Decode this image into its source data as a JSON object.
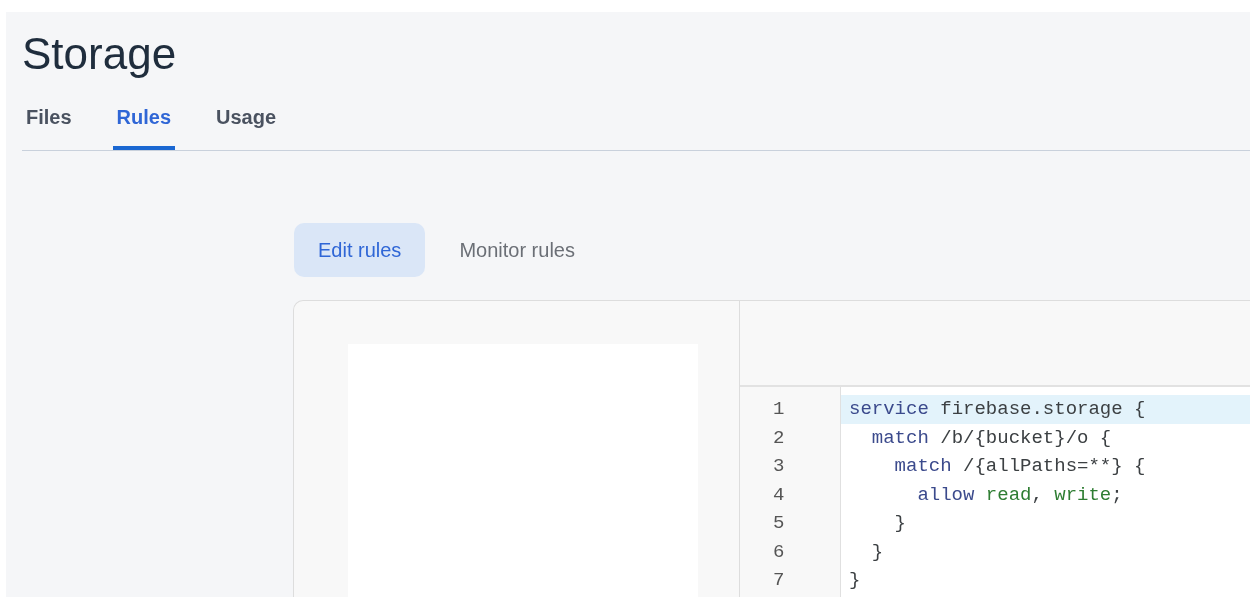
{
  "page": {
    "title": "Storage"
  },
  "tabs": [
    {
      "label": "Files",
      "selected": false
    },
    {
      "label": "Rules",
      "selected": true
    },
    {
      "label": "Usage",
      "selected": false
    }
  ],
  "subtabs": [
    {
      "label": "Edit rules",
      "selected": true
    },
    {
      "label": "Monitor rules",
      "selected": false
    }
  ],
  "editor": {
    "lines": [
      {
        "number": "1",
        "active": true,
        "tokens": [
          {
            "kind": "keyword",
            "text": "service"
          },
          {
            "kind": "plain",
            "text": " firebase.storage {"
          }
        ]
      },
      {
        "number": "2",
        "active": false,
        "tokens": [
          {
            "kind": "keyword",
            "text": "  match"
          },
          {
            "kind": "plain",
            "text": " /b/{bucket}/o {"
          }
        ]
      },
      {
        "number": "3",
        "active": false,
        "tokens": [
          {
            "kind": "keyword",
            "text": "    match"
          },
          {
            "kind": "plain",
            "text": " /{allPaths=**} {"
          }
        ]
      },
      {
        "number": "4",
        "active": false,
        "tokens": [
          {
            "kind": "keyword",
            "text": "      allow"
          },
          {
            "kind": "value",
            "text": " read"
          },
          {
            "kind": "plain",
            "text": ", "
          },
          {
            "kind": "value",
            "text": "write"
          },
          {
            "kind": "plain",
            "text": ";"
          }
        ]
      },
      {
        "number": "5",
        "active": false,
        "tokens": [
          {
            "kind": "plain",
            "text": "    }"
          }
        ]
      },
      {
        "number": "6",
        "active": false,
        "tokens": [
          {
            "kind": "plain",
            "text": "  }"
          }
        ]
      },
      {
        "number": "7",
        "active": false,
        "tokens": [
          {
            "kind": "plain",
            "text": "}"
          }
        ]
      }
    ]
  }
}
